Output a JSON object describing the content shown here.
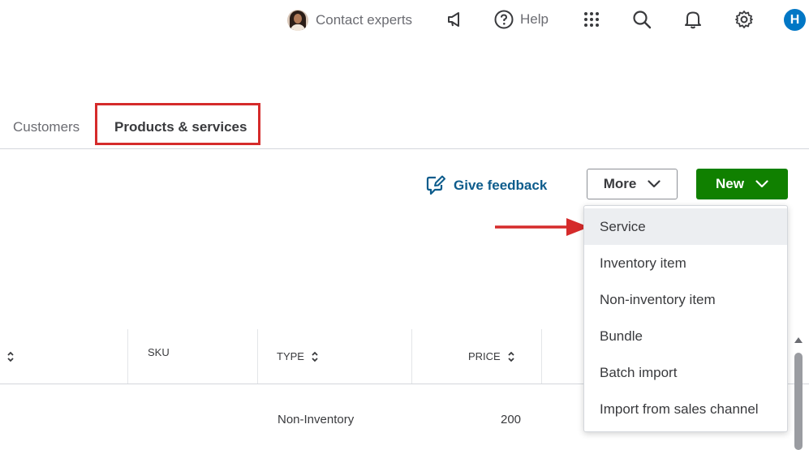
{
  "topbar": {
    "contact_label": "Contact experts",
    "help_label": "Help",
    "user_initial": "H",
    "icons": [
      "announcement-icon",
      "help-icon",
      "apps-grid-icon",
      "search-icon",
      "bell-icon",
      "gear-icon"
    ]
  },
  "tabs": [
    {
      "label": "Customers",
      "selected": false
    },
    {
      "label": "Products & services",
      "selected": true
    }
  ],
  "actions": {
    "feedback_label": "Give feedback",
    "more_label": "More",
    "new_label": "New"
  },
  "new_menu": {
    "items": [
      "Service",
      "Inventory item",
      "Non-inventory item",
      "Bundle",
      "Batch import",
      "Import from sales channel"
    ],
    "highlighted": "Service"
  },
  "table": {
    "headers": {
      "sku": "SKU",
      "type": "TYPE",
      "price": "PRICE"
    },
    "rows": [
      {
        "type": "Non-Inventory",
        "price": "200"
      }
    ]
  },
  "colors": {
    "accent_green": "#108000",
    "link_blue": "#0d5c8c",
    "annotation_red": "#d52b2b",
    "avatar_blue": "#0077c5"
  }
}
